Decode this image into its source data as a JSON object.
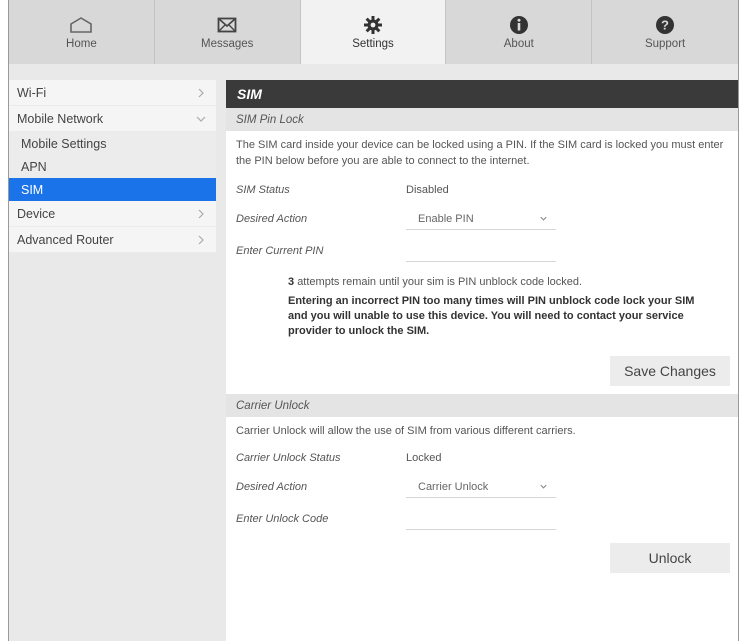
{
  "nav": {
    "tabs": [
      {
        "label": "Home",
        "icon": "home-icon"
      },
      {
        "label": "Messages",
        "icon": "envelope-icon"
      },
      {
        "label": "Settings",
        "icon": "gear-icon"
      },
      {
        "label": "About",
        "icon": "info-icon"
      },
      {
        "label": "Support",
        "icon": "question-icon"
      }
    ],
    "active": "Settings"
  },
  "sidebar": {
    "items": [
      {
        "label": "Wi-Fi"
      },
      {
        "label": "Mobile Network"
      },
      {
        "label": "Device"
      },
      {
        "label": "Advanced Router"
      }
    ],
    "subitems": [
      {
        "label": "Mobile Settings"
      },
      {
        "label": "APN"
      },
      {
        "label": "SIM"
      }
    ],
    "active": "SIM"
  },
  "main": {
    "title": "SIM",
    "sim_pin_lock": {
      "title": "SIM Pin Lock",
      "description": "The SIM card inside your device can be locked using a PIN. If the SIM card is locked you must enter the PIN below before you are able to connect to the internet.",
      "status_label": "SIM Status",
      "status_value": "Disabled",
      "action_label": "Desired Action",
      "action_value": "Enable PIN",
      "pin_label": "Enter Current PIN",
      "attempts_count": "3",
      "attempts_text": "attempts remain until your sim is PIN unblock code locked.",
      "warning": "Entering an incorrect PIN too many times will PIN unblock code lock your SIM and you will unable to use this device. You will need to contact your service provider to unlock the SIM.",
      "save_label": "Save Changes"
    },
    "carrier_unlock": {
      "title": "Carrier Unlock",
      "description": "Carrier Unlock will allow the use of SIM from various different carriers.",
      "status_label": "Carrier Unlock Status",
      "status_value": "Locked",
      "action_label": "Desired Action",
      "action_value": "Carrier Unlock",
      "code_label": "Enter Unlock Code",
      "unlock_label": "Unlock"
    }
  },
  "colors": {
    "active_blue": "#1a73e8",
    "header_dark": "#3a3a3a"
  }
}
